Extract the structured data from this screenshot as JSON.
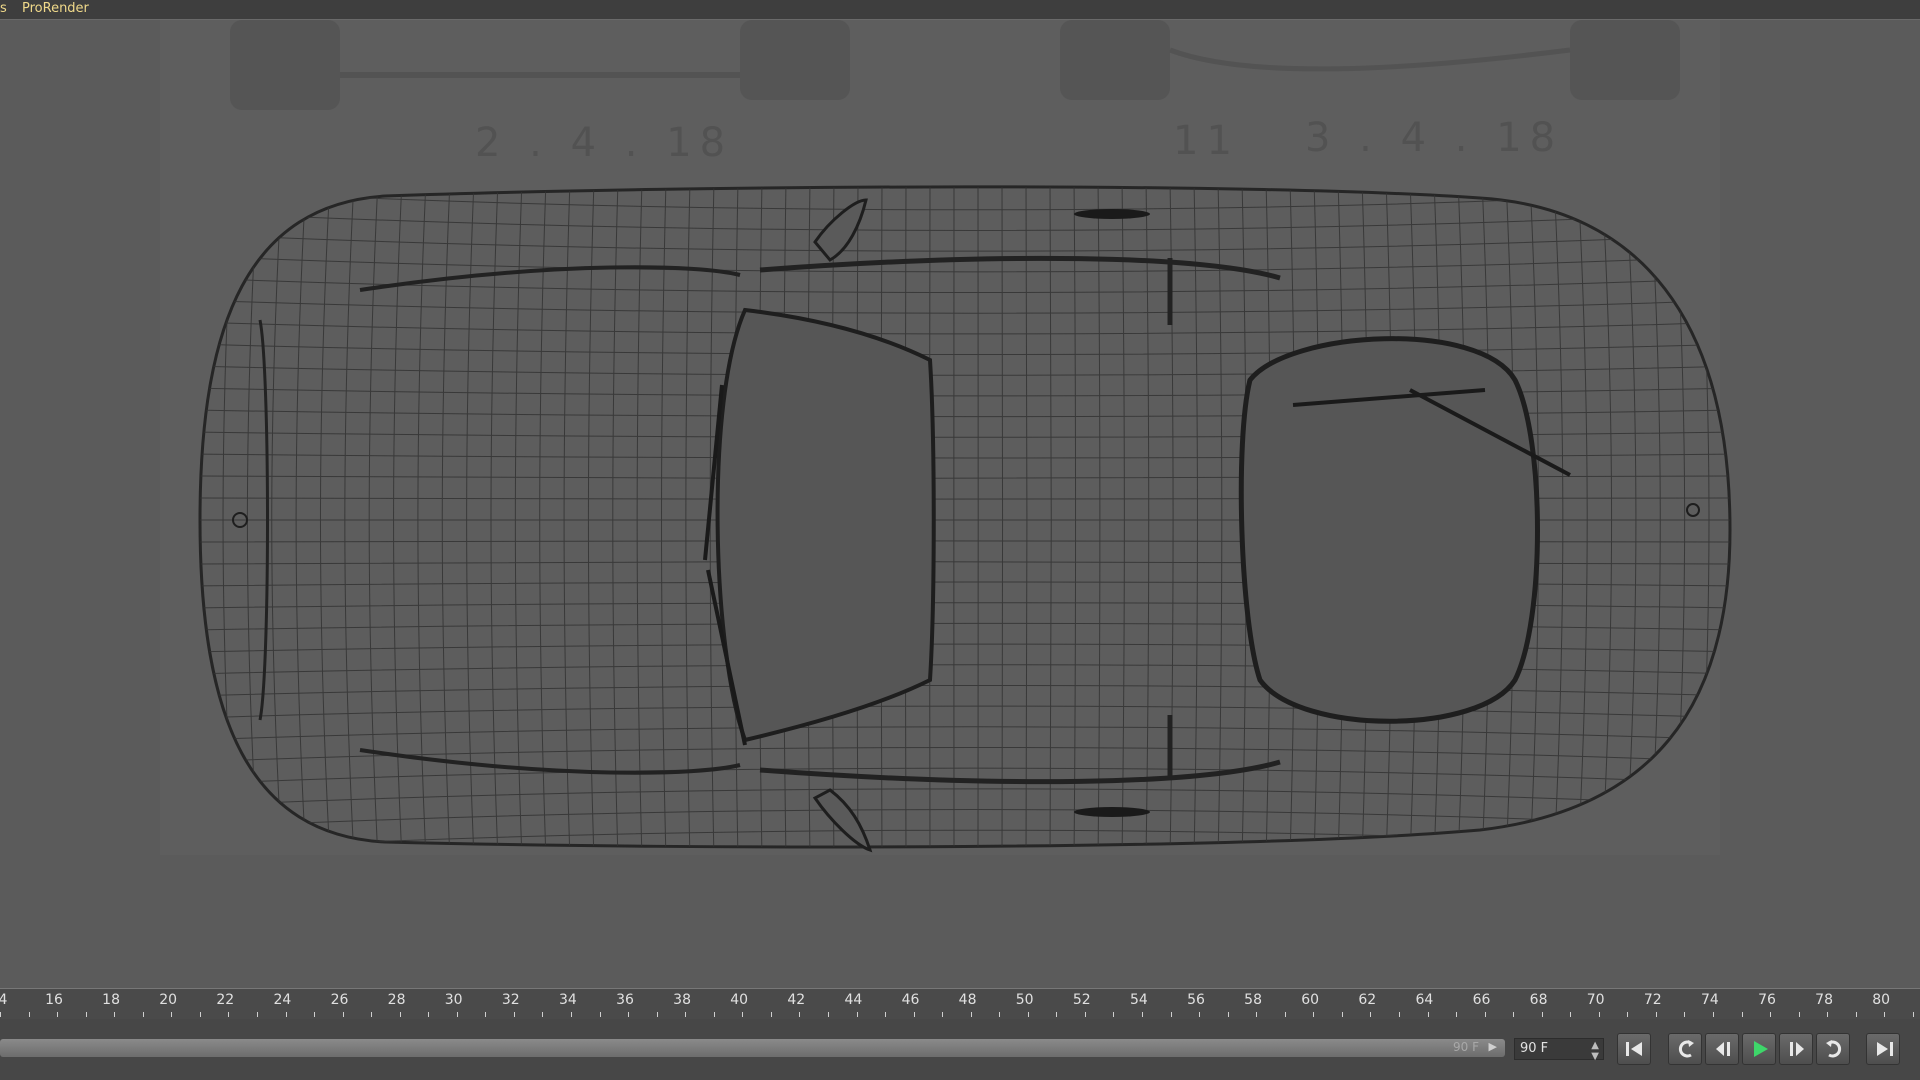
{
  "menubar": {
    "items": [
      {
        "label": "s"
      },
      {
        "label": "ProRender"
      }
    ]
  },
  "viewport": {
    "blueprint_labels": [
      "2 . 4 . 18",
      "11",
      "3 . 4 . 18"
    ]
  },
  "timeline": {
    "labels": [
      "4",
      "16",
      "18",
      "20",
      "22",
      "24",
      "26",
      "28",
      "30",
      "32",
      "34",
      "36",
      "38",
      "40",
      "42",
      "44",
      "46",
      "48",
      "50",
      "52",
      "54",
      "56",
      "58",
      "60",
      "62",
      "64",
      "66",
      "68",
      "70",
      "72",
      "74",
      "76",
      "78",
      "80"
    ]
  },
  "transport": {
    "range_end": "90 F",
    "frame_field": "90 F",
    "buttons": [
      {
        "name": "go-to-start-button",
        "icon": "skip-start-icon"
      },
      {
        "name": "loop-back-button",
        "icon": "loop-back-icon"
      },
      {
        "name": "step-back-button",
        "icon": "step-back-icon"
      },
      {
        "name": "play-button",
        "icon": "play-icon"
      },
      {
        "name": "step-forward-button",
        "icon": "step-forward-icon"
      },
      {
        "name": "loop-forward-button",
        "icon": "loop-forward-icon"
      },
      {
        "name": "go-to-end-button",
        "icon": "skip-end-icon"
      }
    ]
  },
  "colors": {
    "menu_text": "#f0d98a",
    "play_icon": "#3ed66a",
    "background": "#595959"
  }
}
